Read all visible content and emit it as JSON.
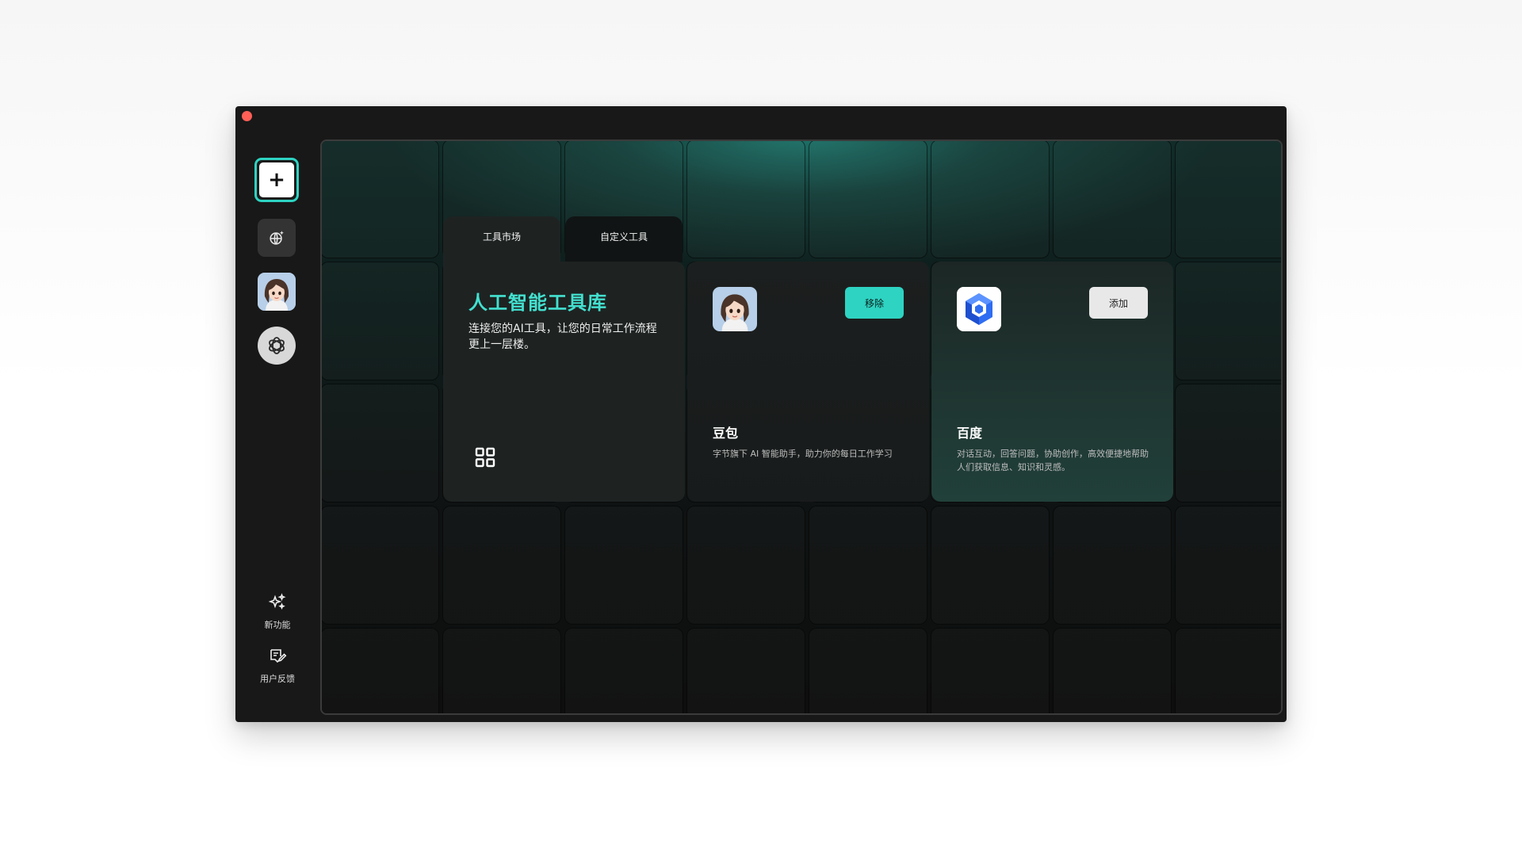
{
  "sidebar": {
    "add_symbol": "+",
    "icons": [
      "add-icon",
      "globe-sparkle-icon",
      "doubao-avatar-icon",
      "openai-icon"
    ],
    "bottom": [
      {
        "label": "新功能",
        "icon": "sparkles-icon"
      },
      {
        "label": "用户反馈",
        "icon": "feedback-icon"
      }
    ]
  },
  "tabs": [
    {
      "label": "工具市场",
      "active": true
    },
    {
      "label": "自定义工具",
      "active": false
    }
  ],
  "intro": {
    "title": "人工智能工具库",
    "description": "连接您的AI工具，让您的日常工作流程更上一层楼。",
    "icon": "grid-icon"
  },
  "tools": [
    {
      "name": "豆包",
      "description": "字节旗下 AI 智能助手，助力你的每日工作学习",
      "button_label": "移除",
      "logo": "doubao-avatar-icon"
    },
    {
      "name": "百度",
      "description": "对话互动，回答问题，协助创作，高效便捷地帮助人们获取信息、知识和灵感。",
      "button_label": "添加",
      "logo": "baidu-cube-icon"
    }
  ],
  "colors": {
    "accent": "#2ed3c2",
    "title_accent": "#43e0cf",
    "window_bg": "#181818",
    "close_dot": "#ff5f57"
  }
}
